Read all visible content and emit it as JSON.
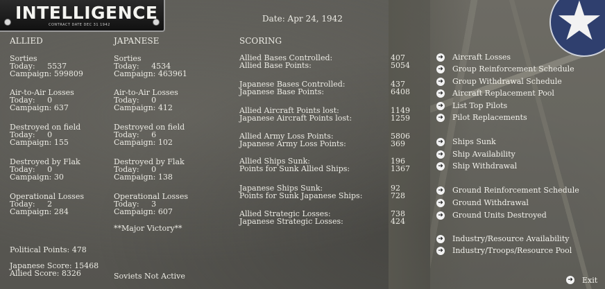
{
  "header": {
    "title": "INTELLIGENCE",
    "subtitle": "CONTRACT DATE DEC 31 1942"
  },
  "date": "Date: Apr 24, 1942",
  "allied": {
    "heading": "ALLIED",
    "sorties": {
      "label": "Sorties",
      "today": "Today:     5537",
      "campaign": "Campaign: 599809"
    },
    "air_to_air": {
      "label": "Air-to-Air Losses",
      "today": "Today:     0",
      "campaign": "Campaign: 637"
    },
    "destroyed_field": {
      "label": "Destroyed on field",
      "today": "Today:     0",
      "campaign": "Campaign: 155"
    },
    "destroyed_flak": {
      "label": "Destroyed by Flak",
      "today": "Today:     0",
      "campaign": "Campaign: 30"
    },
    "operational": {
      "label": "Operational Losses",
      "today": "Today:     2",
      "campaign": "Campaign: 284"
    }
  },
  "japanese": {
    "heading": "JAPANESE",
    "sorties": {
      "label": "Sorties",
      "today": "Today:     4534",
      "campaign": "Campaign: 463961"
    },
    "air_to_air": {
      "label": "Air-to-Air Losses",
      "today": "Today:     0",
      "campaign": "Campaign: 412"
    },
    "destroyed_field": {
      "label": "Destroyed on field",
      "today": "Today:     6",
      "campaign": "Campaign: 102"
    },
    "destroyed_flak": {
      "label": "Destroyed by Flak",
      "today": "Today:     0",
      "campaign": "Campaign: 138"
    },
    "operational": {
      "label": "Operational Losses",
      "today": "Today:     3",
      "campaign": "Campaign: 607"
    },
    "victory": "**Major Victory**"
  },
  "political_points": "Political Points: 478",
  "japanese_score": "Japanese Score: 15468",
  "allied_score": "Allied Score: 8326",
  "soviets": "Soviets Not Active",
  "scoring": {
    "heading": "SCORING",
    "groups": [
      {
        "rows": [
          {
            "label": "Allied Bases Controlled:",
            "value": "407"
          },
          {
            "label": "Allied Base Points:",
            "value": "5054"
          }
        ]
      },
      {
        "rows": [
          {
            "label": "Japanese Bases Controlled:",
            "value": "437"
          },
          {
            "label": "Japanese Base Points:",
            "value": "6408"
          }
        ]
      },
      {
        "rows": [
          {
            "label": "Allied Aircraft Points lost:",
            "value": "1149"
          },
          {
            "label": "Japanese Aircraft Points lost:",
            "value": "1259"
          }
        ]
      },
      {
        "rows": [
          {
            "label": "Allied Army Loss Points:",
            "value": "5806"
          },
          {
            "label": "Japanese Army Loss Points:",
            "value": "369"
          }
        ]
      },
      {
        "rows": [
          {
            "label": "Allied Ships Sunk:",
            "value": "196"
          },
          {
            "label": "Points for Sunk Allied Ships:",
            "value": "1367"
          }
        ]
      },
      {
        "rows": [
          {
            "label": "Japanese Ships Sunk:",
            "value": "92"
          },
          {
            "label": "Points for Sunk Japanese Ships:",
            "value": "728"
          }
        ]
      },
      {
        "rows": [
          {
            "label": "Allied Strategic Losses:",
            "value": "738"
          },
          {
            "label": "Japanese Strategic Losses:",
            "value": "424"
          }
        ]
      }
    ]
  },
  "menu": [
    {
      "label": "Aircraft Losses",
      "icon": "arrow-right-icon"
    },
    {
      "label": "Group Reinforcement Schedule",
      "icon": "arrow-right-icon"
    },
    {
      "label": "Group Withdrawal Schedule",
      "icon": "arrow-right-icon"
    },
    {
      "label": "Aircraft Replacement Pool",
      "icon": "arrow-right-icon"
    },
    {
      "label": "List Top Pilots",
      "icon": "arrow-right-icon"
    },
    {
      "label": "Pilot Replacements",
      "icon": "arrow-right-icon"
    },
    {
      "label": "Ships Sunk",
      "icon": "arrow-right-icon"
    },
    {
      "label": "Ship Availability",
      "icon": "arrow-right-icon"
    },
    {
      "label": "Ship Withdrawal",
      "icon": "arrow-right-icon"
    },
    {
      "label": "Ground Reinforcement Schedule",
      "icon": "arrow-right-icon"
    },
    {
      "label": "Ground Withdrawal",
      "icon": "arrow-right-icon"
    },
    {
      "label": "Ground Units Destroyed",
      "icon": "arrow-right-icon"
    },
    {
      "label": "Industry/Resource Availability",
      "icon": "arrow-right-icon"
    },
    {
      "label": "Industry/Troops/Resource Pool",
      "icon": "arrow-right-icon"
    }
  ],
  "exit_label": "Exit",
  "colors": {
    "background": "#5b5a55",
    "text": "#ecebe4",
    "roundel_blue": "#2f3f6e"
  }
}
